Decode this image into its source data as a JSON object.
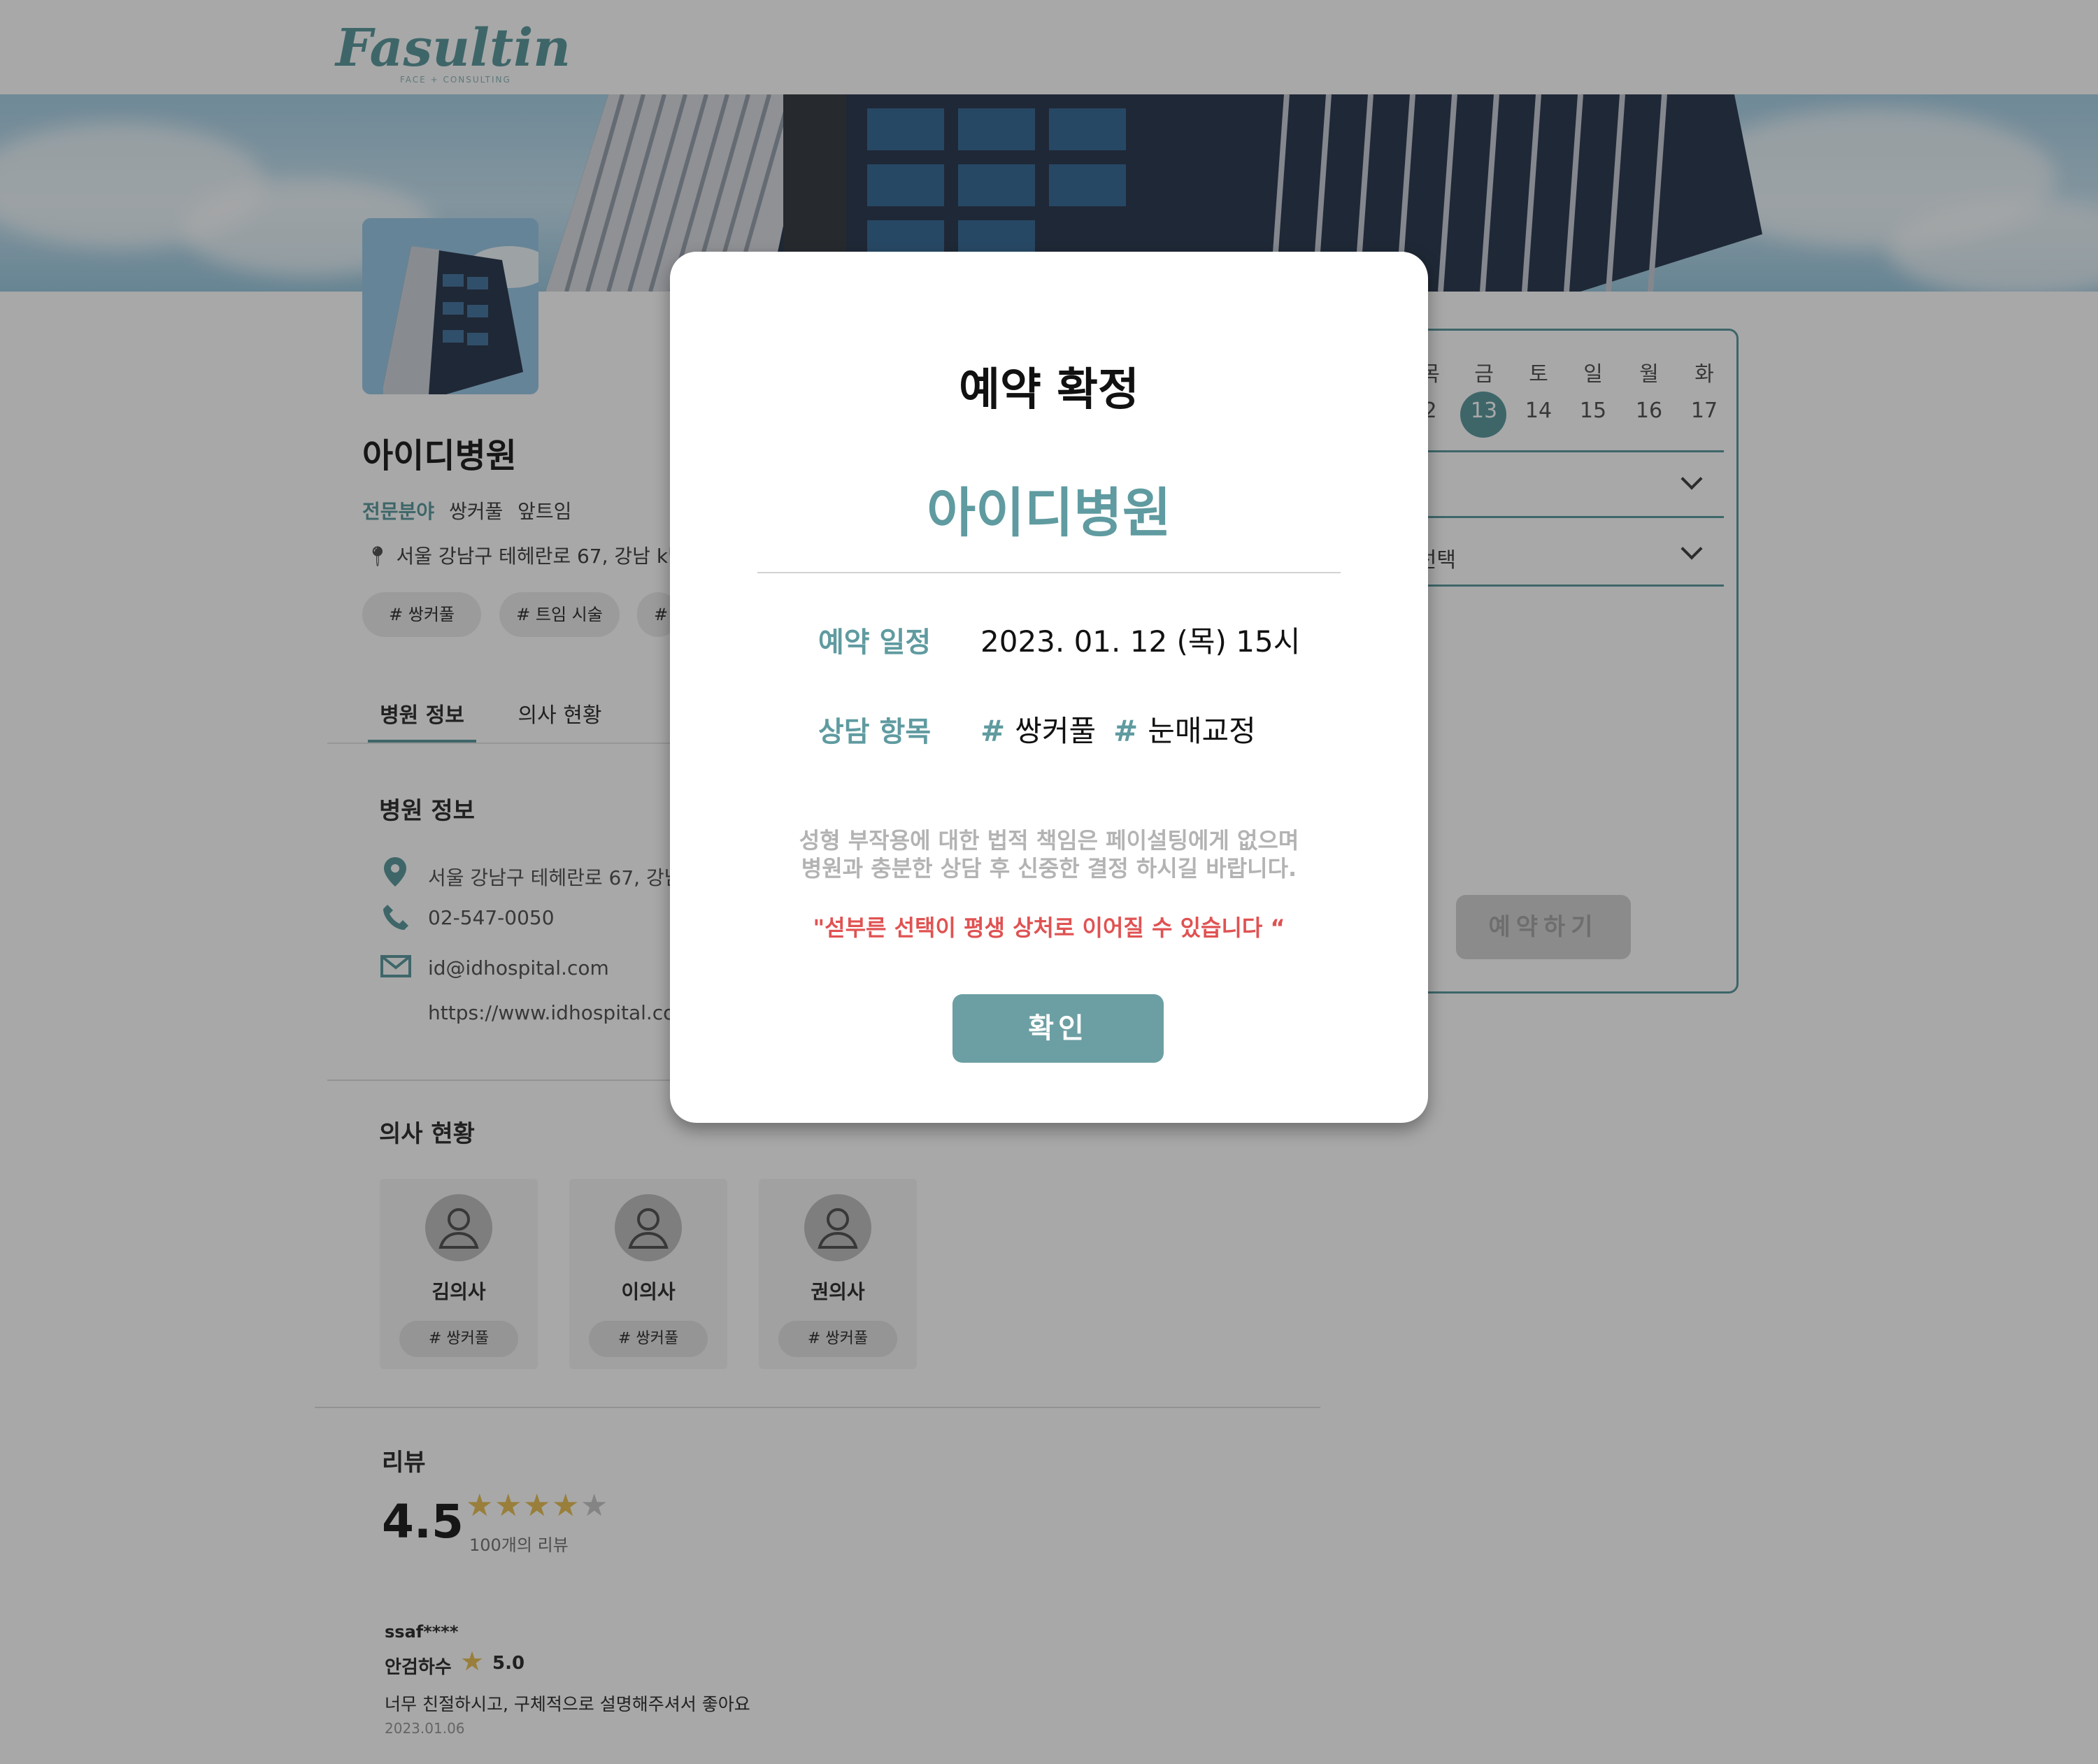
{
  "header": {
    "logo_text": "Fasulting",
    "logo_subtext": "FACE + CONSULTING"
  },
  "hospital": {
    "name": "아이디병원",
    "specialty_label": "전문분야",
    "specialties": [
      "쌍커풀",
      "앞트임"
    ],
    "address_short": "서울 강남구 테헤란로 67, 강남 k빌",
    "tags": [
      "# 쌍커풀",
      "# 트임 시술",
      "#"
    ]
  },
  "tabs": [
    "병원 정보",
    "의사 현황"
  ],
  "info_section": {
    "title": "병원 정보",
    "address": "서울 강남구 테헤란로 67, 강남",
    "phone": "02-547-0050",
    "email": "id@idhospital.com",
    "website": "https://www.idhospital.co"
  },
  "doctors_section": {
    "title": "의사 현황",
    "doctors": [
      {
        "name": "김의사",
        "tag": "# 쌍커풀"
      },
      {
        "name": "이의사",
        "tag": "# 쌍커풀"
      },
      {
        "name": "권의사",
        "tag": "# 쌍커풀"
      }
    ]
  },
  "review_section": {
    "title": "리뷰",
    "rating": "4.5",
    "rating_value": 4.5,
    "rating_max": 5,
    "count_text": "100개의 리뷰",
    "reviews": [
      {
        "user": "ssaf****",
        "doctor": "안검하수",
        "score": "5.0",
        "text": "너무 친절하시고, 구체적으로 설명해주셔서 좋아요",
        "date": "2023.01.06"
      }
    ]
  },
  "reservation_panel": {
    "days": [
      "목",
      "금",
      "토",
      "일",
      "월",
      "화"
    ],
    "dates": [
      "2",
      "13",
      "14",
      "15",
      "16",
      "17"
    ],
    "selected_date": "13",
    "select_1": "선택",
    "select_2": "항목 선택",
    "reserve_button": "예약하기"
  },
  "modal": {
    "title": "예약 확정",
    "hospital_name": "아이디병원",
    "schedule_label": "예약 일정",
    "schedule_value": "2023. 01. 12 (목) 15시",
    "items_label": "상담 항목",
    "items": [
      "쌍커풀",
      "눈매교정"
    ],
    "notice_line1": "성형 부작용에 대한 법적 책임은 페이설팅에게 없으며",
    "notice_line2": "병원과 충분한 상담 후 신중한 결정 하시길 바랍니다.",
    "warning": "\"섣부른 선택이 평생 상처로 이어질 수 있습니다 “",
    "confirm_button": "확인"
  },
  "colors": {
    "accent": "#5f9ba0",
    "warning": "#e05252",
    "star": "#e8c15a"
  }
}
